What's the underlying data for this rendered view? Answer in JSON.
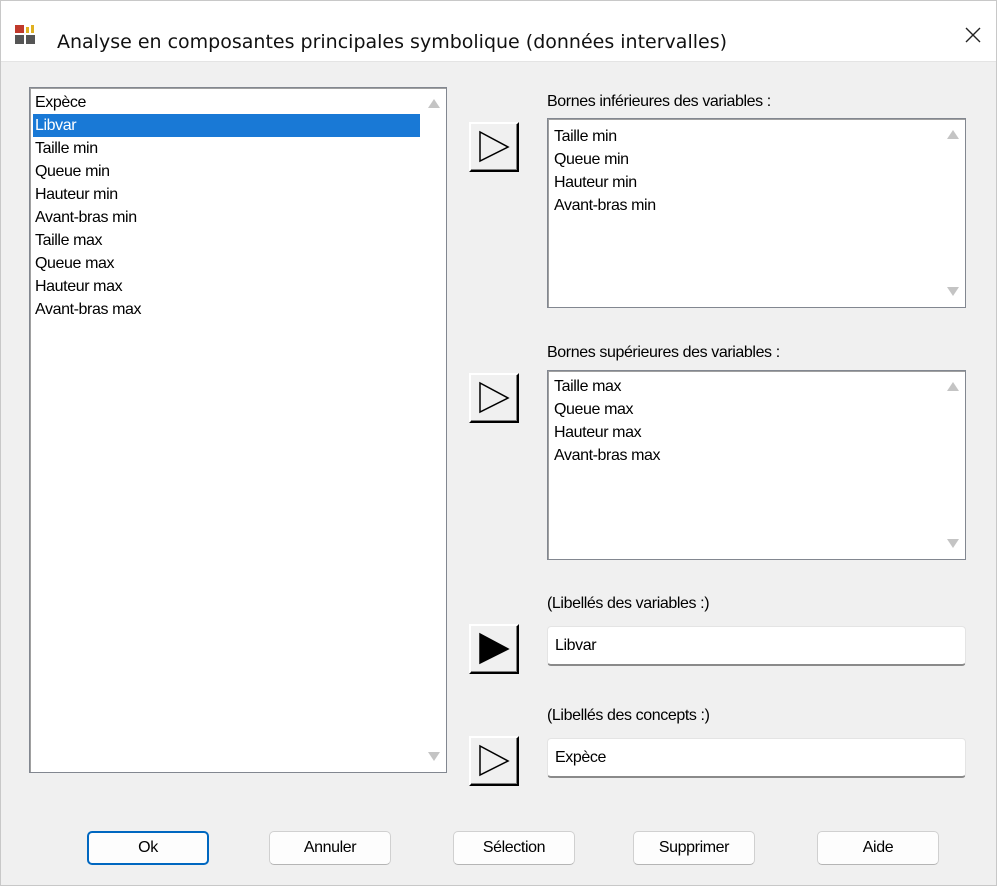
{
  "window": {
    "title": "Analyse en composantes principales symbolique (données intervalles)",
    "close_glyph": "✕"
  },
  "source_list": {
    "items": [
      "Expèce",
      "Libvar",
      "Taille min",
      "Queue min",
      "Hauteur min",
      "Avant-bras min",
      "Taille max",
      "Queue max",
      "Hauteur max",
      "Avant-bras max"
    ],
    "selected": "Libvar"
  },
  "lower_bounds": {
    "label": "Bornes inférieures des variables :",
    "items": [
      "Taille min",
      "Queue min",
      "Hauteur min",
      "Avant-bras min"
    ]
  },
  "upper_bounds": {
    "label": "Bornes supérieures des variables :",
    "items": [
      "Taille max",
      "Queue max",
      "Hauteur max",
      "Avant-bras max"
    ]
  },
  "variable_labels": {
    "label": "(Libellés des variables :)",
    "value": "Libvar"
  },
  "concept_labels": {
    "label": "(Libellés des concepts :)",
    "value": "Expèce"
  },
  "buttons": {
    "ok": "Ok",
    "cancel": "Annuler",
    "selection": "Sélection",
    "delete": "Supprimer",
    "help": "Aide"
  },
  "icons": {
    "app": "app-grid-icon",
    "close": "close-icon",
    "arrow_outline": "play-arrow-outline-icon",
    "arrow_filled": "play-arrow-filled-icon"
  },
  "colors": {
    "selection": "#1979d6",
    "default_button_border": "#0067c0",
    "app_icon_red": "#c0392b",
    "app_icon_yellow": "#e0b020"
  }
}
